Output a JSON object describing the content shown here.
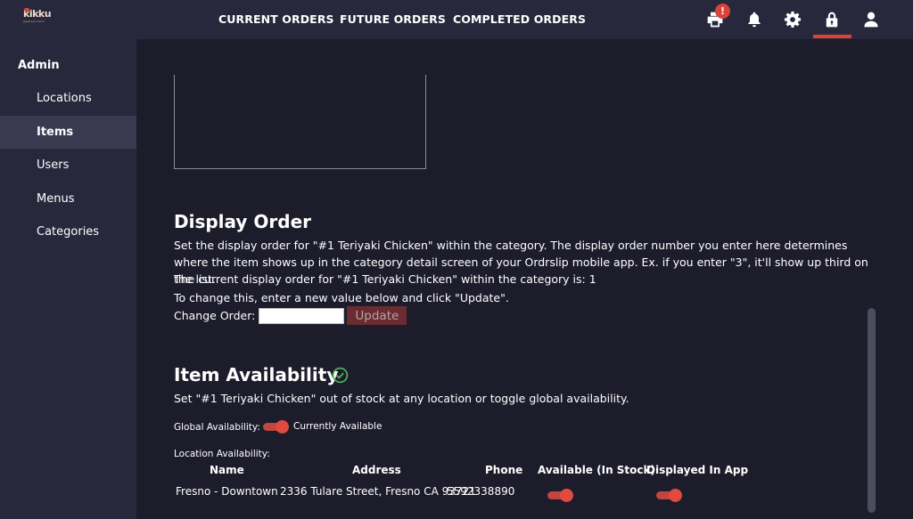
{
  "brand": {
    "logo_text": "kikku",
    "logo_sub": "japanese fusion",
    "accent_color": "#d9433b"
  },
  "topnav": {
    "items": [
      "CURRENT ORDERS",
      "FUTURE ORDERS",
      "COMPLETED ORDERS"
    ],
    "print_badge": "!",
    "icons": [
      "printer-icon",
      "bell-icon",
      "gear-icon",
      "lock-icon",
      "user-icon"
    ],
    "active_icon": "lock-icon"
  },
  "sidebar": {
    "title": "Admin",
    "items": [
      {
        "label": "Locations",
        "active": false
      },
      {
        "label": "Items",
        "active": true
      },
      {
        "label": "Users",
        "active": false
      },
      {
        "label": "Menus",
        "active": false
      },
      {
        "label": "Categories",
        "active": false
      }
    ]
  },
  "display_order": {
    "title": "Display Order",
    "description": "Set the display order for \"#1 Teriyaki Chicken\" within the category. The display order number you enter here determines where the item shows up in the category detail screen of your Ordrslip mobile app. Ex. if you enter \"3\", it'll show up third on the list.",
    "current": "The current display order for \"#1 Teriyaki Chicken\" within the category is: 1",
    "instruction": "To change this, enter a new value below and click \"Update\".",
    "change_label": "Change Order:",
    "input_value": "",
    "update_label": "Update"
  },
  "availability": {
    "title": "Item Availability",
    "description": "Set \"#1 Teriyaki Chicken\" out of stock at any location or toggle global availability.",
    "global_label": "Global Availability:",
    "global_status": "Currently Available",
    "global_on": true,
    "location_label": "Location Availability:",
    "columns": [
      "Name",
      "Address",
      "Phone",
      "Available (In Stock)",
      "Displayed In App"
    ],
    "rows": [
      {
        "name": "Fresno - Downtown",
        "address": "2336 Tulare Street, Fresno CA 93721",
        "phone": "5592338890",
        "available": true,
        "displayed": true
      }
    ]
  }
}
